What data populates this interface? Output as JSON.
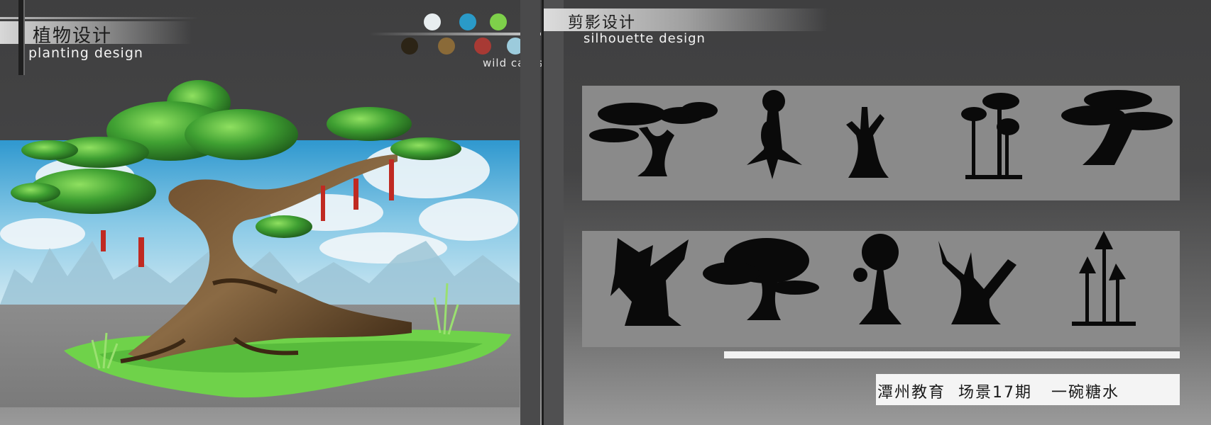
{
  "left_header": {
    "title_cn": "植物设计",
    "title_en": "planting design"
  },
  "right_header": {
    "title_cn": "剪影设计",
    "title_en": "silhouette design"
  },
  "palette": {
    "label": "wild cards",
    "colors": [
      "#e8eef0",
      "#2a9ac8",
      "#7ed04a",
      "#103a14",
      "#2c2416",
      "#8a6a38",
      "#a83a34",
      "#9ccbdc"
    ]
  },
  "footer": {
    "credit": "潭州教育  场景17期   一碗糖水"
  }
}
